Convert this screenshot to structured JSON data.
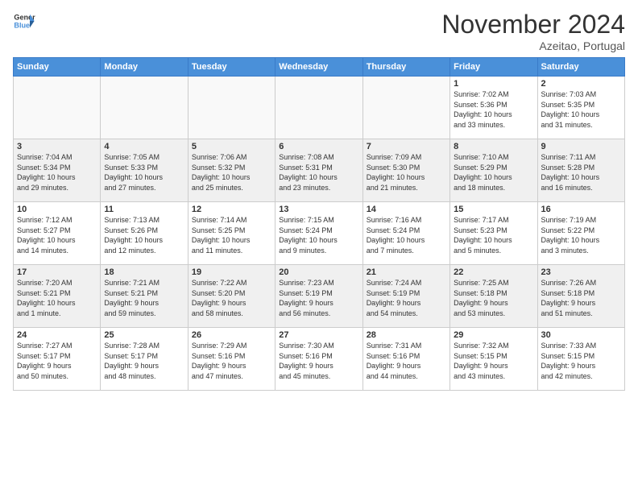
{
  "header": {
    "logo_line1": "General",
    "logo_line2": "Blue",
    "month": "November 2024",
    "location": "Azeitao, Portugal"
  },
  "weekdays": [
    "Sunday",
    "Monday",
    "Tuesday",
    "Wednesday",
    "Thursday",
    "Friday",
    "Saturday"
  ],
  "weeks": [
    [
      {
        "day": "",
        "info": ""
      },
      {
        "day": "",
        "info": ""
      },
      {
        "day": "",
        "info": ""
      },
      {
        "day": "",
        "info": ""
      },
      {
        "day": "",
        "info": ""
      },
      {
        "day": "1",
        "info": "Sunrise: 7:02 AM\nSunset: 5:36 PM\nDaylight: 10 hours\nand 33 minutes."
      },
      {
        "day": "2",
        "info": "Sunrise: 7:03 AM\nSunset: 5:35 PM\nDaylight: 10 hours\nand 31 minutes."
      }
    ],
    [
      {
        "day": "3",
        "info": "Sunrise: 7:04 AM\nSunset: 5:34 PM\nDaylight: 10 hours\nand 29 minutes."
      },
      {
        "day": "4",
        "info": "Sunrise: 7:05 AM\nSunset: 5:33 PM\nDaylight: 10 hours\nand 27 minutes."
      },
      {
        "day": "5",
        "info": "Sunrise: 7:06 AM\nSunset: 5:32 PM\nDaylight: 10 hours\nand 25 minutes."
      },
      {
        "day": "6",
        "info": "Sunrise: 7:08 AM\nSunset: 5:31 PM\nDaylight: 10 hours\nand 23 minutes."
      },
      {
        "day": "7",
        "info": "Sunrise: 7:09 AM\nSunset: 5:30 PM\nDaylight: 10 hours\nand 21 minutes."
      },
      {
        "day": "8",
        "info": "Sunrise: 7:10 AM\nSunset: 5:29 PM\nDaylight: 10 hours\nand 18 minutes."
      },
      {
        "day": "9",
        "info": "Sunrise: 7:11 AM\nSunset: 5:28 PM\nDaylight: 10 hours\nand 16 minutes."
      }
    ],
    [
      {
        "day": "10",
        "info": "Sunrise: 7:12 AM\nSunset: 5:27 PM\nDaylight: 10 hours\nand 14 minutes."
      },
      {
        "day": "11",
        "info": "Sunrise: 7:13 AM\nSunset: 5:26 PM\nDaylight: 10 hours\nand 12 minutes."
      },
      {
        "day": "12",
        "info": "Sunrise: 7:14 AM\nSunset: 5:25 PM\nDaylight: 10 hours\nand 11 minutes."
      },
      {
        "day": "13",
        "info": "Sunrise: 7:15 AM\nSunset: 5:24 PM\nDaylight: 10 hours\nand 9 minutes."
      },
      {
        "day": "14",
        "info": "Sunrise: 7:16 AM\nSunset: 5:24 PM\nDaylight: 10 hours\nand 7 minutes."
      },
      {
        "day": "15",
        "info": "Sunrise: 7:17 AM\nSunset: 5:23 PM\nDaylight: 10 hours\nand 5 minutes."
      },
      {
        "day": "16",
        "info": "Sunrise: 7:19 AM\nSunset: 5:22 PM\nDaylight: 10 hours\nand 3 minutes."
      }
    ],
    [
      {
        "day": "17",
        "info": "Sunrise: 7:20 AM\nSunset: 5:21 PM\nDaylight: 10 hours\nand 1 minute."
      },
      {
        "day": "18",
        "info": "Sunrise: 7:21 AM\nSunset: 5:21 PM\nDaylight: 9 hours\nand 59 minutes."
      },
      {
        "day": "19",
        "info": "Sunrise: 7:22 AM\nSunset: 5:20 PM\nDaylight: 9 hours\nand 58 minutes."
      },
      {
        "day": "20",
        "info": "Sunrise: 7:23 AM\nSunset: 5:19 PM\nDaylight: 9 hours\nand 56 minutes."
      },
      {
        "day": "21",
        "info": "Sunrise: 7:24 AM\nSunset: 5:19 PM\nDaylight: 9 hours\nand 54 minutes."
      },
      {
        "day": "22",
        "info": "Sunrise: 7:25 AM\nSunset: 5:18 PM\nDaylight: 9 hours\nand 53 minutes."
      },
      {
        "day": "23",
        "info": "Sunrise: 7:26 AM\nSunset: 5:18 PM\nDaylight: 9 hours\nand 51 minutes."
      }
    ],
    [
      {
        "day": "24",
        "info": "Sunrise: 7:27 AM\nSunset: 5:17 PM\nDaylight: 9 hours\nand 50 minutes."
      },
      {
        "day": "25",
        "info": "Sunrise: 7:28 AM\nSunset: 5:17 PM\nDaylight: 9 hours\nand 48 minutes."
      },
      {
        "day": "26",
        "info": "Sunrise: 7:29 AM\nSunset: 5:16 PM\nDaylight: 9 hours\nand 47 minutes."
      },
      {
        "day": "27",
        "info": "Sunrise: 7:30 AM\nSunset: 5:16 PM\nDaylight: 9 hours\nand 45 minutes."
      },
      {
        "day": "28",
        "info": "Sunrise: 7:31 AM\nSunset: 5:16 PM\nDaylight: 9 hours\nand 44 minutes."
      },
      {
        "day": "29",
        "info": "Sunrise: 7:32 AM\nSunset: 5:15 PM\nDaylight: 9 hours\nand 43 minutes."
      },
      {
        "day": "30",
        "info": "Sunrise: 7:33 AM\nSunset: 5:15 PM\nDaylight: 9 hours\nand 42 minutes."
      }
    ]
  ],
  "gray_rows": [
    1,
    3
  ]
}
